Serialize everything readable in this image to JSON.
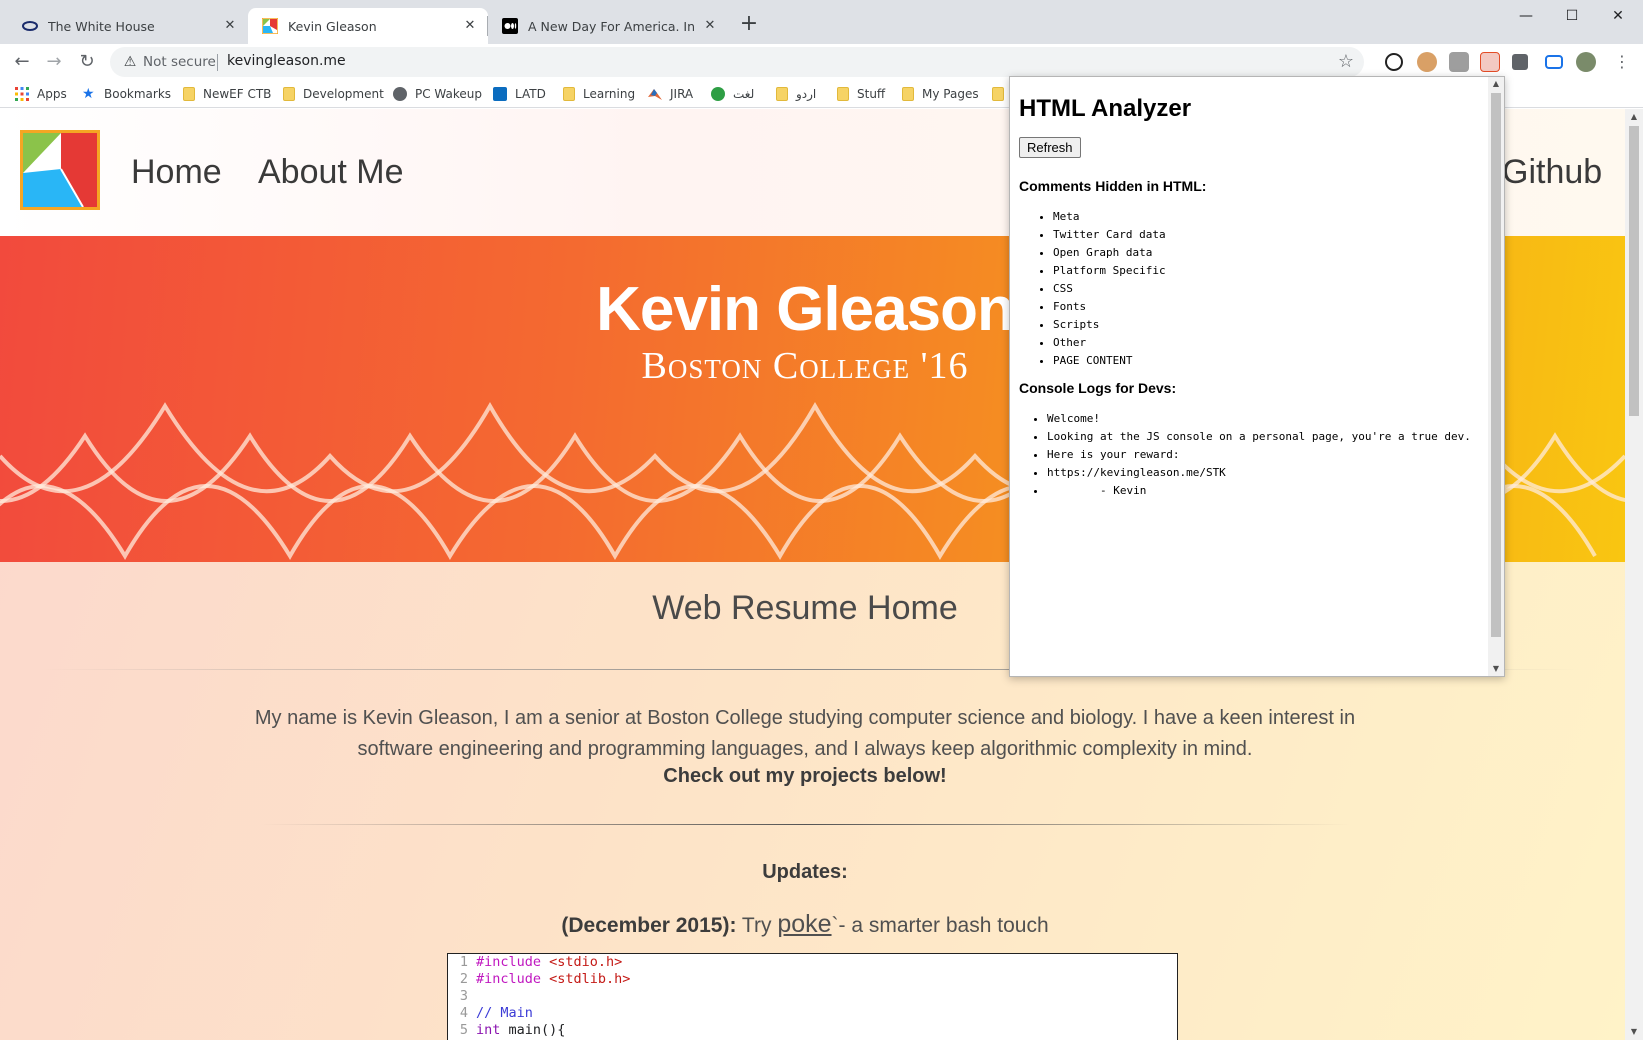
{
  "tabs": [
    {
      "title": "The White House",
      "close": "✕"
    },
    {
      "title": "Kevin Gleason",
      "close": "✕"
    },
    {
      "title": "A New Day For America. In his ina",
      "close": "✕"
    }
  ],
  "newtab": "+",
  "window_controls": {
    "minimize": "—",
    "maximize": "☐",
    "close": "✕"
  },
  "toolbar": {
    "back": "←",
    "forward": "→",
    "reload": "↻",
    "security_icon": "⚠",
    "security_text": "Not secure",
    "url": "kevingleason.me",
    "star": "☆"
  },
  "bookmarks": [
    {
      "label": "Apps",
      "icon": "apps-icon"
    },
    {
      "label": "Bookmarks",
      "icon": "star-icon"
    },
    {
      "label": "NewEF CTB",
      "icon": "folder-icon"
    },
    {
      "label": "Development",
      "icon": "folder-icon"
    },
    {
      "label": "PC Wakeup",
      "icon": "globe-icon"
    },
    {
      "label": "LATD",
      "icon": "sharepoint-icon"
    },
    {
      "label": "Learning",
      "icon": "folder-icon"
    },
    {
      "label": "JIRA",
      "icon": "matlab-icon"
    },
    {
      "label": "لغت",
      "icon": "green-icon"
    },
    {
      "label": "اردو",
      "icon": "folder-icon"
    },
    {
      "label": "Stuff",
      "icon": "folder-icon"
    },
    {
      "label": "My Pages",
      "icon": "folder-icon"
    }
  ],
  "site": {
    "nav": {
      "home": "Home",
      "about": "About Me",
      "github": "Github"
    },
    "hero_name": "Kevin Gleason",
    "hero_sub": "Boston College '16",
    "section_title": "Web Resume Home",
    "bio": "My name is Kevin Gleason, I am a senior at Boston College studying computer science and biology. I have a keen interest in software engineering and programming languages, and I always keep algorithmic complexity in mind.",
    "bio_cta": "Check out my projects below!",
    "updates_heading": "Updates:",
    "update_date": "(December 2015):",
    "update_try": " Try ",
    "update_link": "poke",
    "update_rest": "`- a smarter bash touch",
    "code_lines": [
      {
        "n": "1",
        "pp": "#include",
        "inc": " <stdio.h>"
      },
      {
        "n": "2",
        "pp": "#include",
        "inc": " <stdlib.h>"
      },
      {
        "n": "3"
      },
      {
        "n": "4",
        "cm": "// Main"
      },
      {
        "n": "5",
        "kw": "int",
        "rest": " main(){"
      }
    ]
  },
  "analyzer": {
    "title": "HTML Analyzer",
    "refresh": "Refresh",
    "comments_heading": "Comments Hidden in HTML:",
    "comments": [
      "Meta",
      "Twitter Card data",
      "Open Graph data",
      "Platform Specific",
      "CSS",
      "Fonts",
      "Scripts",
      "Other",
      "PAGE CONTENT"
    ],
    "console_heading": "Console Logs for Devs:",
    "console": [
      "Welcome!",
      "Looking at the JS console on a personal page, you're a true dev.",
      "Here is your reward:",
      "https://kevingleason.me/STK",
      "        - Kevin"
    ]
  }
}
